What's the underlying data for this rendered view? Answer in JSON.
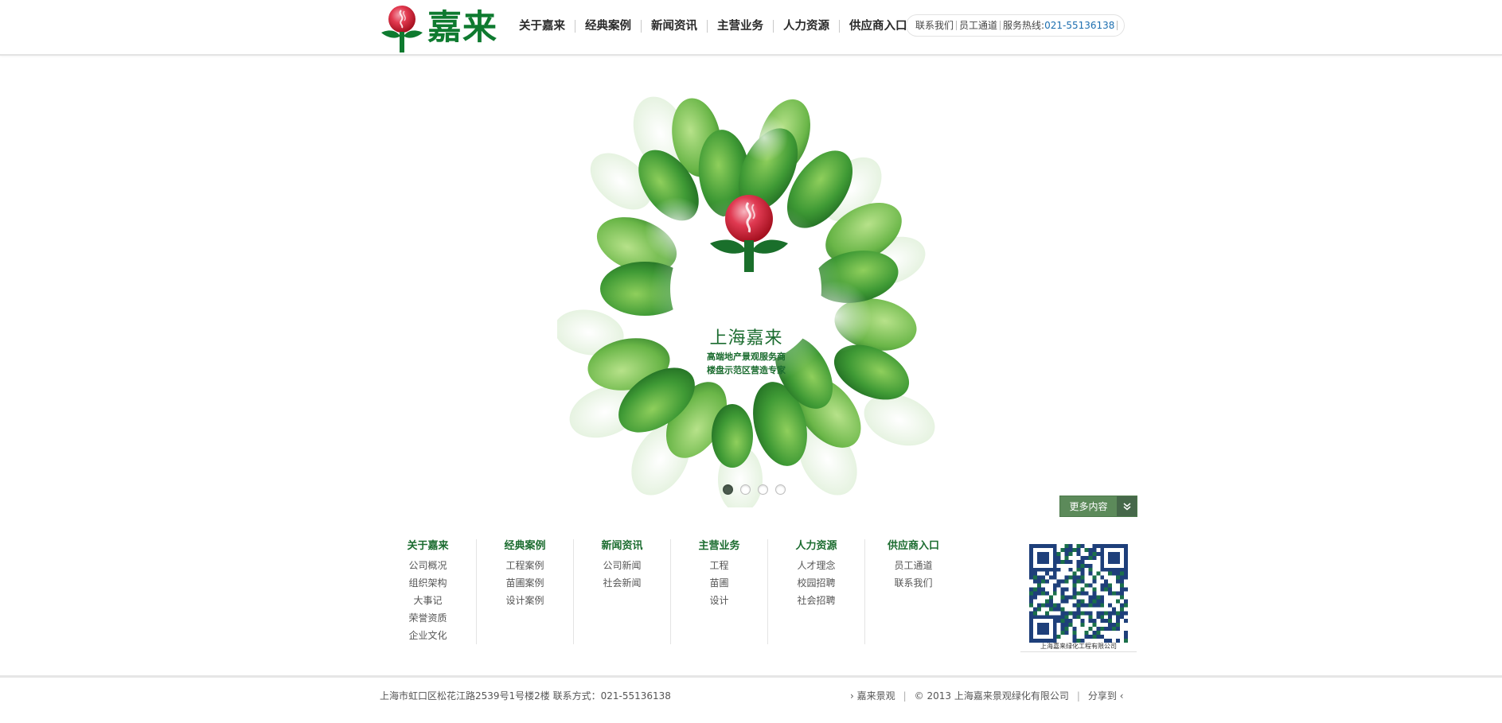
{
  "brand": {
    "name": "嘉来",
    "accent": "#0e7a2f",
    "flower_red": "#d6283a"
  },
  "nav": {
    "items": [
      "关于嘉来",
      "经典案例",
      "新闻资讯",
      "主营业务",
      "人力资源",
      "供应商入口"
    ]
  },
  "top_links": {
    "contact": "联系我们",
    "staff": "员工通道",
    "hotline_label": "服务热线:",
    "hotline_number": "021-55136138"
  },
  "banner": {
    "brand_name": "上海嘉来",
    "slogan_1": "高端地产景观服务商",
    "slogan_2": "楼盘示范区营造专家",
    "slides": 4,
    "active_slide": 1,
    "more_label": "更多内容",
    "more_icon": "double-chevron-down-icon"
  },
  "footer_columns": [
    {
      "title": "关于嘉来",
      "links": [
        "公司概况",
        "组织架构",
        "大事记",
        "荣誉资质",
        "企业文化"
      ]
    },
    {
      "title": "经典案例",
      "links": [
        "工程案例",
        "苗圃案例",
        "设计案例"
      ]
    },
    {
      "title": "新闻资讯",
      "links": [
        "公司新闻",
        "社会新闻"
      ]
    },
    {
      "title": "主营业务",
      "links": [
        "工程",
        "苗圃",
        "设计"
      ]
    },
    {
      "title": "人力资源",
      "links": [
        "人才理念",
        "校园招聘",
        "社会招聘"
      ]
    },
    {
      "title": "供应商入口",
      "links": [
        "员工通道",
        "联系我们"
      ]
    }
  ],
  "qr": {
    "caption": "上海嘉来绿化工程有限公司"
  },
  "bottom": {
    "address": "上海市虹口区松花江路2539号1号楼2楼 联系方式：021-55136138",
    "link_1": "› 嘉来景观",
    "copyright": "© 2013 上海嘉来景观绿化有限公司",
    "share": "分享到 ‹"
  }
}
